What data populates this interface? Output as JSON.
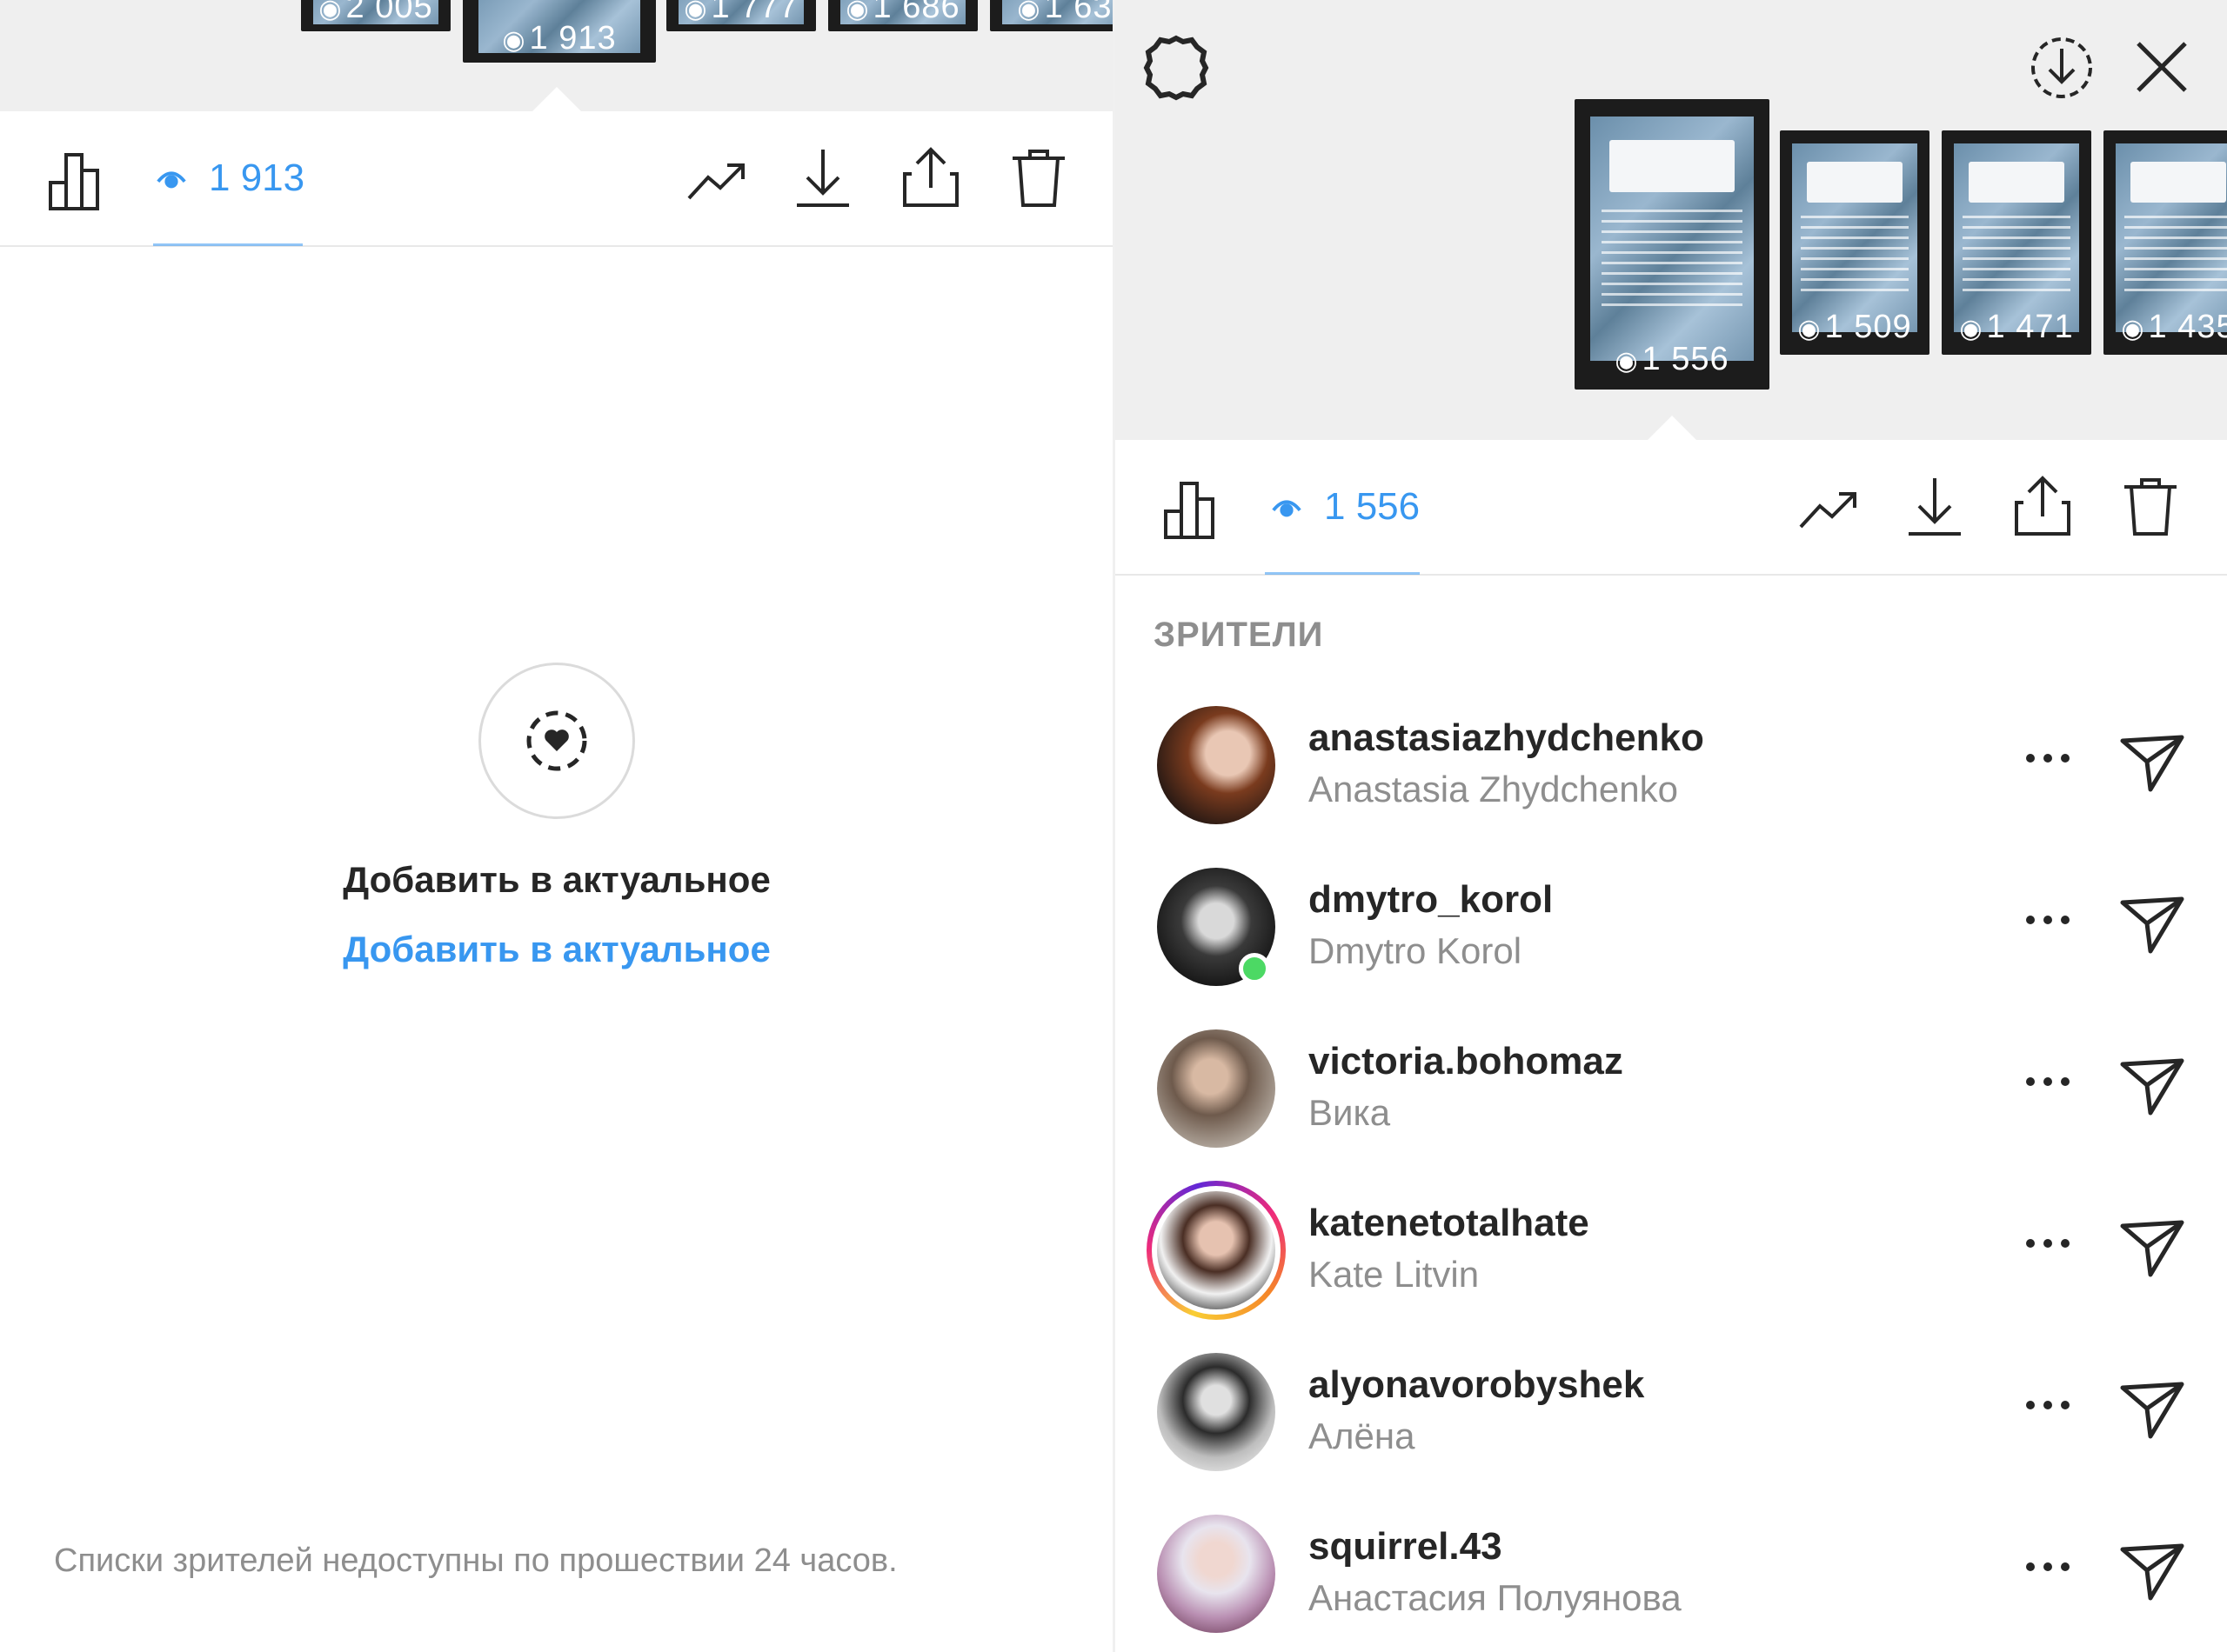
{
  "left": {
    "thumbnails": [
      {
        "views": "2 005"
      },
      {
        "views": "1 913",
        "selected": true
      },
      {
        "views": "1 777"
      },
      {
        "views": "1 686"
      },
      {
        "views": "1 63"
      }
    ],
    "toolbar": {
      "views_count": "1 913",
      "icons": [
        "bar-chart-icon",
        "eye-icon",
        "trending-icon",
        "download-icon",
        "share-icon",
        "trash-icon"
      ]
    },
    "highlight": {
      "title": "Добавить в актуальное",
      "link": "Добавить в актуальное",
      "icon": "heart-highlight-icon"
    },
    "footnote": "Списки зрителей недоступны по прошествии 24 часов."
  },
  "right": {
    "top_icons": [
      "settings-icon",
      "download-circle-icon",
      "close-icon"
    ],
    "thumbnails": [
      {
        "views": "1 556",
        "selected": true
      },
      {
        "views": "1 509"
      },
      {
        "views": "1 471"
      },
      {
        "views": "1 435"
      }
    ],
    "toolbar": {
      "views_count": "1 556"
    },
    "section_title": "ЗРИТЕЛИ",
    "viewers": [
      {
        "username": "anastasiazhydchenko",
        "full_name": "Anastasia Zhydchenko",
        "online": false,
        "story_ring": false
      },
      {
        "username": "dmytro_korol",
        "full_name": "Dmytro Korol",
        "online": true,
        "story_ring": false
      },
      {
        "username": "victoria.bohomaz",
        "full_name": "Вика",
        "online": false,
        "story_ring": false
      },
      {
        "username": "katenetotalhate",
        "full_name": "Kate Litvin",
        "online": false,
        "story_ring": true
      },
      {
        "username": "alyonavorobyshek",
        "full_name": "Алёна",
        "online": false,
        "story_ring": false
      },
      {
        "username": "squirrel.43",
        "full_name": "Анастасия Полуянова",
        "online": false,
        "story_ring": false
      }
    ]
  },
  "colors": {
    "accent": "#3897f0",
    "muted": "#8e8e8e",
    "text": "#262626",
    "online": "#4cd964"
  }
}
